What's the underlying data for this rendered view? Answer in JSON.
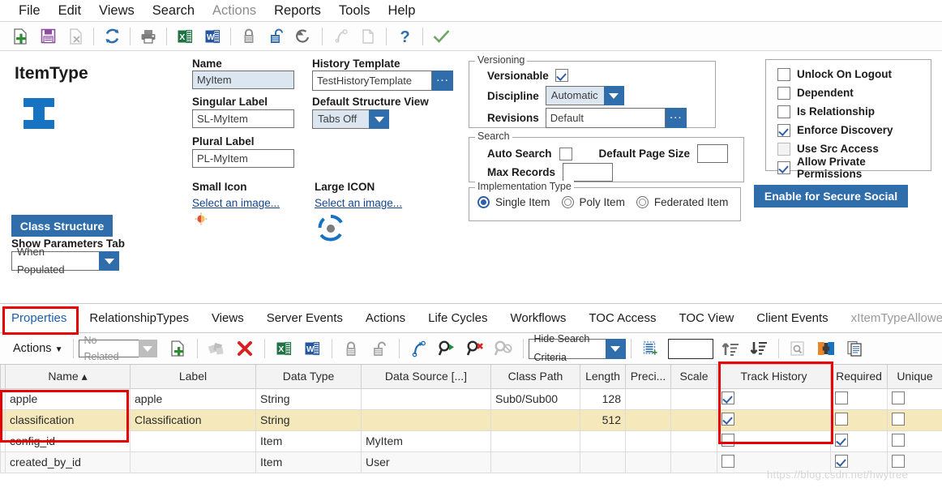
{
  "menu": {
    "items": [
      {
        "label": "File",
        "dim": false
      },
      {
        "label": "Edit",
        "dim": false
      },
      {
        "label": "Views",
        "dim": false
      },
      {
        "label": "Search",
        "dim": false
      },
      {
        "label": "Actions",
        "dim": true
      },
      {
        "label": "Reports",
        "dim": false
      },
      {
        "label": "Tools",
        "dim": false
      },
      {
        "label": "Help",
        "dim": false
      }
    ]
  },
  "toolbar": {
    "icons": [
      "new-document-icon",
      "save-icon",
      "delete-document-icon",
      "refresh-icon",
      "print-icon",
      "export-excel-icon",
      "export-word-icon",
      "lock-icon",
      "unlock-icon",
      "undo-icon",
      "redo-icon",
      "copy-icon",
      "help-icon",
      "done-icon"
    ]
  },
  "form": {
    "item_type_title": "ItemType",
    "item_icon_name": "itemtype-glyph-icon",
    "class_structure_button": "Class Structure",
    "show_parameters_label": "Show Parameters Tab",
    "show_parameters_value": "When Populated",
    "name_label": "Name",
    "name_value": "MyItem",
    "singular_label_label": "Singular Label",
    "singular_label_value": "SL-MyItem",
    "plural_label_label": "Plural Label",
    "plural_label_value": "PL-MyItem",
    "small_icon_label": "Small Icon",
    "small_icon_link": "Select an image...",
    "history_template_label": "History Template",
    "history_template_value": "TestHistoryTemplate",
    "default_structure_view_label": "Default Structure View",
    "default_structure_view_value": "Tabs Off",
    "large_icon_label": "Large ICON",
    "large_icon_link": "Select an image...",
    "ellipsis_button": "...",
    "versioning": {
      "caption": "Versioning",
      "versionable_label": "Versionable",
      "versionable_checked": true,
      "discipline_label": "Discipline",
      "discipline_value": "Automatic",
      "revisions_label": "Revisions",
      "revisions_value": "Default"
    },
    "search": {
      "caption": "Search",
      "auto_search_label": "Auto Search",
      "auto_search_checked": false,
      "default_page_size_label": "Default Page Size",
      "default_page_size_value": "",
      "max_records_label": "Max Records",
      "max_records_value": ""
    },
    "implementation": {
      "caption": "Implementation Type",
      "options": [
        {
          "label": "Single Item",
          "selected": true
        },
        {
          "label": "Poly Item",
          "selected": false
        },
        {
          "label": "Federated Item",
          "selected": false
        }
      ]
    },
    "flags": [
      {
        "label": "Unlock On Logout",
        "checked": false,
        "disabled": false
      },
      {
        "label": "Dependent",
        "checked": false,
        "disabled": false
      },
      {
        "label": "Is Relationship",
        "checked": false,
        "disabled": false
      },
      {
        "label": "Enforce Discovery",
        "checked": true,
        "disabled": false
      },
      {
        "label": "Use Src Access",
        "checked": false,
        "disabled": true
      },
      {
        "label": "Allow Private Permissions",
        "checked": true,
        "disabled": false
      }
    ],
    "secure_social_button": "Enable for Secure Social"
  },
  "tabs": [
    {
      "label": "Properties",
      "active": true,
      "dim": false
    },
    {
      "label": "RelationshipTypes",
      "active": false,
      "dim": false
    },
    {
      "label": "Views",
      "active": false,
      "dim": false
    },
    {
      "label": "Server Events",
      "active": false,
      "dim": false
    },
    {
      "label": "Actions",
      "active": false,
      "dim": false
    },
    {
      "label": "Life Cycles",
      "active": false,
      "dim": false
    },
    {
      "label": "Workflows",
      "active": false,
      "dim": false
    },
    {
      "label": "TOC Access",
      "active": false,
      "dim": false
    },
    {
      "label": "TOC View",
      "active": false,
      "dim": false
    },
    {
      "label": "Client Events",
      "active": false,
      "dim": false
    },
    {
      "label": "xItemTypeAllowedPrope",
      "active": false,
      "dim": true
    }
  ],
  "grid_toolbar": {
    "actions_label": "Actions",
    "related_value": "No Related",
    "search_criteria_value": "Hide Search Criteria",
    "page_value": "",
    "icons": [
      "add-row-icon",
      "purge-icon",
      "delete-row-icon",
      "export-excel-icon",
      "export-word-icon",
      "lock-icon",
      "unlock-icon",
      "redo-icon",
      "run-search-icon",
      "clear-search-icon",
      "disabled-search-icon",
      "select-all-icon",
      "sort-ascending-icon",
      "sort-descending-icon",
      "find-icon",
      "add-property-icon",
      "copy-rows-icon"
    ]
  },
  "grid": {
    "columns": [
      {
        "label": "Name ▴",
        "width": 160,
        "align": "center"
      },
      {
        "label": "Label",
        "width": 155,
        "align": "center"
      },
      {
        "label": "Data Type",
        "width": 130,
        "align": "center"
      },
      {
        "label": "Data Source [...]",
        "width": 160,
        "align": "center"
      },
      {
        "label": "Class Path",
        "width": 110,
        "align": "center"
      },
      {
        "label": "Length",
        "width": 56,
        "align": "center"
      },
      {
        "label": "Preci...",
        "width": 56,
        "align": "center"
      },
      {
        "label": "Scale",
        "width": 57,
        "align": "center"
      },
      {
        "label": "Track History",
        "width": 140,
        "align": "center"
      },
      {
        "label": "Required",
        "width": 70,
        "align": "center"
      },
      {
        "label": "Unique",
        "width": 68,
        "align": "center"
      }
    ],
    "rows": [
      {
        "state": "normal",
        "name": "apple",
        "label": "apple",
        "data_type": "String",
        "data_source": "",
        "class_path": "Sub0/Sub00",
        "length": "128",
        "precision": "",
        "scale": "",
        "track_history": true,
        "required": false,
        "unique": false
      },
      {
        "state": "selected",
        "name": "classification",
        "label": "Classification",
        "data_type": "String",
        "data_source": "",
        "class_path": "",
        "length": "512",
        "precision": "",
        "scale": "",
        "track_history": true,
        "required": false,
        "unique": false
      },
      {
        "state": "normal",
        "name": "config_id",
        "label": "",
        "data_type": "Item",
        "data_source": "MyItem",
        "class_path": "",
        "length": "",
        "precision": "",
        "scale": "",
        "track_history": false,
        "required": true,
        "unique": false
      },
      {
        "state": "alt",
        "name": "created_by_id",
        "label": "",
        "data_type": "Item",
        "data_source": "User",
        "class_path": "",
        "length": "",
        "precision": "",
        "scale": "",
        "track_history": false,
        "required": true,
        "unique": false
      }
    ]
  },
  "watermark": "https://blog.csdn.net/hwytree",
  "colors": {
    "accent_blue": "#2f6dab",
    "link_blue": "#15458f",
    "selected_row": "#f5e9bb",
    "readonly_field": "#dce6f1",
    "annotation_red": "#e60000"
  }
}
